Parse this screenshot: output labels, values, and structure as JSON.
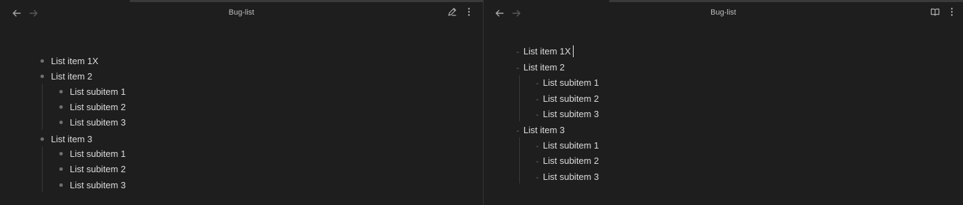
{
  "left_pane": {
    "title": "Bug-list",
    "back_icon": "arrow-left-icon",
    "forward_icon": "arrow-right-icon",
    "edit_icon": "pencil-icon",
    "more_icon": "more-vertical-icon",
    "list": [
      {
        "label": "List item 1X",
        "children": []
      },
      {
        "label": "List item 2",
        "children": [
          "List subitem 1",
          "List subitem 2",
          "List subitem 3"
        ]
      },
      {
        "label": "List item 3",
        "children": [
          "List subitem 1",
          "List subitem 2",
          "List subitem 3"
        ]
      }
    ]
  },
  "right_pane": {
    "title": "Bug-list",
    "back_icon": "arrow-left-icon",
    "forward_icon": "arrow-right-icon",
    "reading_icon": "book-open-icon",
    "more_icon": "more-vertical-icon",
    "list_marker": "-",
    "list": [
      {
        "label": "List item 1X",
        "children": []
      },
      {
        "label": "List item 2",
        "children": [
          "List subitem 1",
          "List subitem 2",
          "List subitem 3"
        ]
      },
      {
        "label": "List item 3",
        "children": [
          "List subitem 1",
          "List subitem 2",
          "List subitem 3"
        ]
      }
    ]
  },
  "colors": {
    "background": "#1e1e1e",
    "text": "#dcdcdc",
    "muted": "#707070",
    "divider": "#363636"
  }
}
